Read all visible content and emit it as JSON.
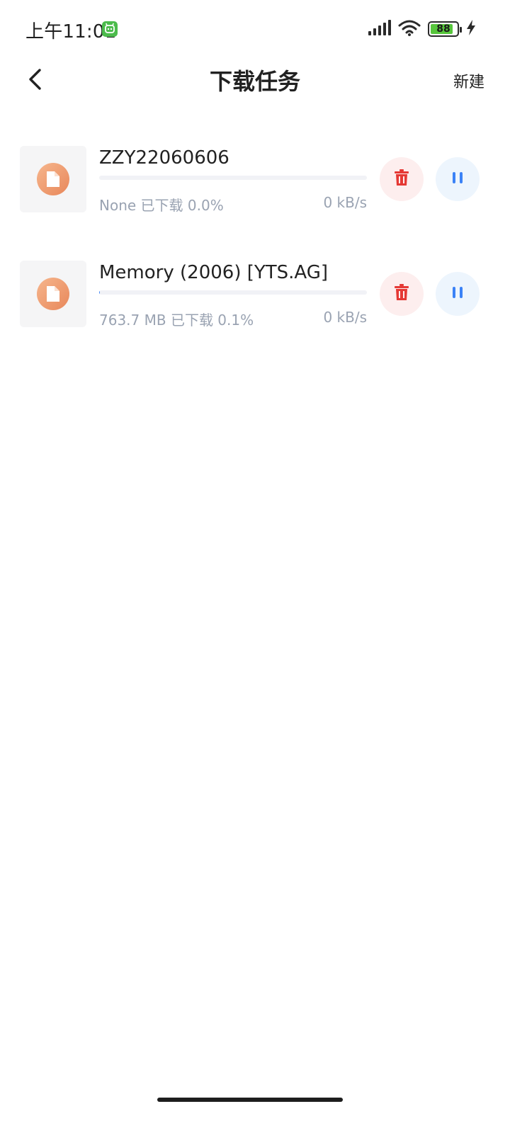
{
  "status_bar": {
    "time": "上午11:01",
    "battery_level": "88",
    "battery_fraction": 0.88,
    "icons": [
      "notification-app-icon",
      "signal-icon",
      "wifi-icon",
      "battery-icon",
      "charging-icon"
    ]
  },
  "header": {
    "title": "下载任务",
    "new_label": "新建",
    "icons": [
      "back-arrow-icon"
    ]
  },
  "colors": {
    "delete_accent": "#e53935",
    "pause_accent": "#3b82f6",
    "meta_text": "#9aa3b2",
    "file_icon": "#ee9264"
  },
  "tasks": [
    {
      "name": "ZZY22060606",
      "meta": "None 已下载 0.0%",
      "speed": "0 kB/s",
      "progress_fraction": 0.0
    },
    {
      "name": "Memory (2006) [YTS.AG]",
      "meta": "763.7 MB 已下载 0.1%",
      "speed": "0 kB/s",
      "progress_fraction": 0.001
    }
  ]
}
